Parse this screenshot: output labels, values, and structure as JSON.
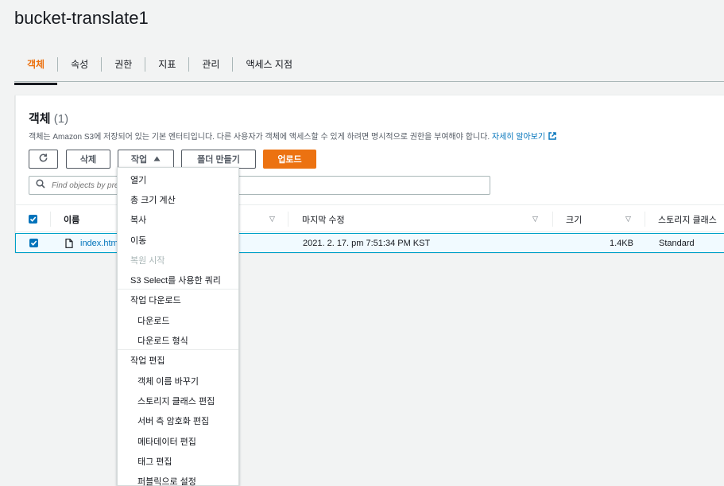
{
  "page": {
    "title": "bucket-translate1"
  },
  "tabs": [
    {
      "label": "객체",
      "active": true
    },
    {
      "label": "속성"
    },
    {
      "label": "권한"
    },
    {
      "label": "지표"
    },
    {
      "label": "관리"
    },
    {
      "label": "액세스 지점"
    }
  ],
  "objects": {
    "heading": "객체",
    "count": "(1)",
    "description": "객체는 Amazon S3에 저장되어 있는 기본 엔터티입니다. 다른 사용자가 객체에 액세스할 수 있게 하려면 명시적으로 권한을 부여해야 합니다.",
    "learn_more": "자세히 알아보기",
    "toolbar": {
      "refresh_icon": "refresh-icon",
      "delete_label": "삭제",
      "actions_label": "작업",
      "create_folder_label": "폴더 만들기",
      "upload_label": "업로드"
    },
    "search": {
      "placeholder": "Find objects by prefix"
    },
    "columns": {
      "name": "이름",
      "last_modified": "마지막 수정",
      "size": "크기",
      "storage_class": "스토리지 클래스"
    },
    "rows": [
      {
        "name": "index.html",
        "last_modified": "2021. 2. 17. pm 7:51:34 PM KST",
        "size": "1.4KB",
        "storage_class": "Standard",
        "selected": true
      }
    ]
  },
  "actions_menu": {
    "open": "열기",
    "calc_size": "총 크기 계산",
    "copy": "복사",
    "move": "이동",
    "restore": "복원 시작",
    "s3_select": "S3 Select를 사용한 쿼리",
    "download_group": "작업 다운로드",
    "download": "다운로드",
    "download_as": "다운로드 형식",
    "edit_group": "작업 편집",
    "rename": "객체 이름 바꾸기",
    "edit_storage_class": "스토리지 클래스 편집",
    "edit_encryption": "서버 측 암호화 편집",
    "edit_metadata": "메타데이터 편집",
    "edit_tags": "태그 편집",
    "make_public": "퍼블릭으로 설정"
  },
  "colors": {
    "accent": "#ec7211",
    "link": "#0073bb",
    "selection_border": "#00a1c9",
    "selection_bg": "#f1faff"
  }
}
